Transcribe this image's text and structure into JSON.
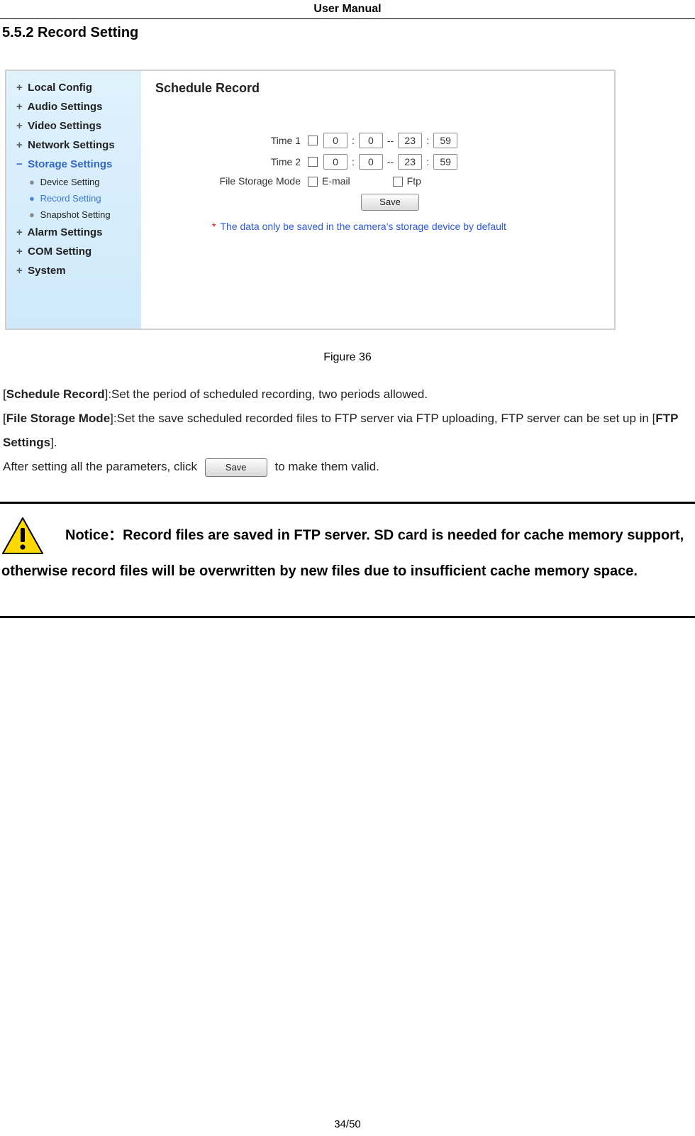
{
  "header": {
    "title": "User Manual"
  },
  "section": {
    "heading": "5.5.2 Record Setting"
  },
  "screenshot": {
    "panel_title": "Schedule Record",
    "sidebar": {
      "items": [
        {
          "label": "Local Config",
          "type": "top"
        },
        {
          "label": "Audio Settings",
          "type": "top"
        },
        {
          "label": "Video Settings",
          "type": "top"
        },
        {
          "label": "Network Settings",
          "type": "top"
        },
        {
          "label": "Storage Settings",
          "type": "top-active"
        },
        {
          "label": "Device Setting",
          "type": "sub"
        },
        {
          "label": "Record Setting",
          "type": "sub-active"
        },
        {
          "label": "Snapshot Setting",
          "type": "sub"
        },
        {
          "label": "Alarm Settings",
          "type": "top"
        },
        {
          "label": "COM Setting",
          "type": "top"
        },
        {
          "label": "System",
          "type": "top"
        }
      ]
    },
    "form": {
      "time1_label": "Time 1",
      "time2_label": "Time 2",
      "time1": {
        "h1": "0",
        "m1": "0",
        "h2": "23",
        "m2": "59"
      },
      "time2": {
        "h1": "0",
        "m1": "0",
        "h2": "23",
        "m2": "59"
      },
      "colon": ":",
      "dash": "--",
      "storage_label": "File Storage Mode",
      "opt_email": "E-mail",
      "opt_ftp": "Ftp",
      "save_label": "Save"
    },
    "note": {
      "asterisk": "*",
      "text": "The data only be saved in the camera's storage device by default"
    }
  },
  "figure_caption": "Figure 36",
  "paragraphs": {
    "schedule_term": "Schedule Record",
    "schedule_desc": "]:Set the period of scheduled recording, two periods allowed.",
    "storagemode_term": "File Storage Mode",
    "storagemode_desc_a": "]:Set the save scheduled recorded files to FTP server via FTP uploading, FTP server can be set up in [",
    "ftp_term": "FTP Settings",
    "storagemode_desc_b": "].",
    "after_a": "After setting all the parameters, click ",
    "save_inline": "Save",
    "after_b": " to make them valid."
  },
  "notice": {
    "label": "Notice：",
    "text": "Record files are saved in FTP server. SD card is needed for cache memory support, otherwise record files will be overwritten by new files due to insufficient cache memory space."
  },
  "footer": {
    "page": "34/50"
  }
}
